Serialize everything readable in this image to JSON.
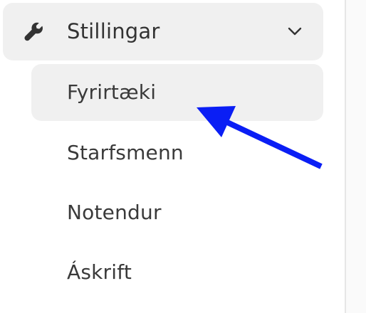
{
  "sidebar": {
    "section": {
      "label": "Stillingar",
      "icon": "wrench-icon",
      "expand_icon": "chevron-down-icon"
    },
    "items": [
      {
        "label": "Fyrirtæki",
        "active": true
      },
      {
        "label": "Starfsmenn",
        "active": false
      },
      {
        "label": "Notendur",
        "active": false
      },
      {
        "label": "Áskrift",
        "active": false
      }
    ]
  },
  "annotation": {
    "icon": "pointer-arrow-icon",
    "color": "#0a1ef5"
  },
  "colors": {
    "highlight_bg": "#f0f0f0",
    "text": "#333333"
  }
}
